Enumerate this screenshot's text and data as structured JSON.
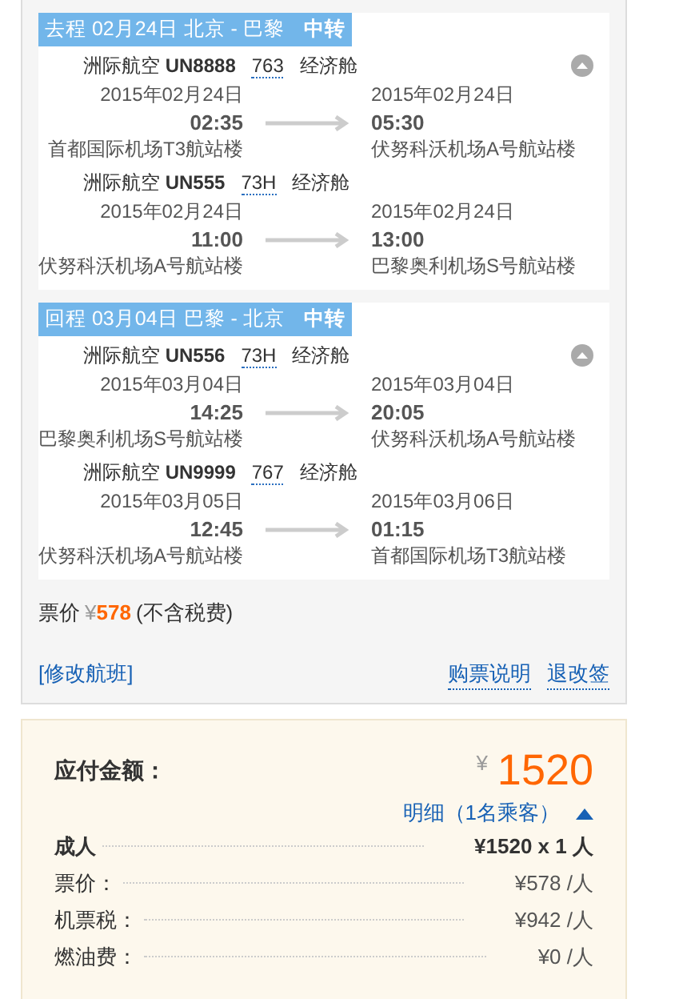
{
  "trips": [
    {
      "label": "去程 02月24日 北京 - 巴黎",
      "tag": "中转",
      "expanded": true,
      "segments": [
        {
          "airline": "洲际航空",
          "flight": "UN8888",
          "aircraft": "763",
          "cabin": "经济舱",
          "depart": {
            "date": "2015年02月24日",
            "time": "02:35",
            "airport": "首都国际机场T3航站楼"
          },
          "arrive": {
            "date": "2015年02月24日",
            "time": "05:30",
            "airport": "伏努科沃机场A号航站楼"
          }
        },
        {
          "airline": "洲际航空",
          "flight": "UN555",
          "aircraft": "73H",
          "cabin": "经济舱",
          "depart": {
            "date": "2015年02月24日",
            "time": "11:00",
            "airport": "伏努科沃机场A号航站楼"
          },
          "arrive": {
            "date": "2015年02月24日",
            "time": "13:00",
            "airport": "巴黎奥利机场S号航站楼"
          }
        }
      ]
    },
    {
      "label": "回程 03月04日 巴黎 - 北京",
      "tag": "中转",
      "expanded": true,
      "segments": [
        {
          "airline": "洲际航空",
          "flight": "UN556",
          "aircraft": "73H",
          "cabin": "经济舱",
          "depart": {
            "date": "2015年03月04日",
            "time": "14:25",
            "airport": "巴黎奥利机场S号航站楼"
          },
          "arrive": {
            "date": "2015年03月04日",
            "time": "20:05",
            "airport": "伏努科沃机场A号航站楼"
          }
        },
        {
          "airline": "洲际航空",
          "flight": "UN9999",
          "aircraft": "767",
          "cabin": "经济舱",
          "depart": {
            "date": "2015年03月05日",
            "time": "12:45",
            "airport": "伏努科沃机场A号航站楼"
          },
          "arrive": {
            "date": "2015年03月06日",
            "time": "01:15",
            "airport": "首都国际机场T3航站楼"
          }
        }
      ]
    }
  ],
  "fare": {
    "label": "票价",
    "currency": "¥",
    "amount": "578",
    "note": "(不含税费)"
  },
  "links": {
    "change": "[修改航班]",
    "actions": [
      "购票说明",
      "退改签"
    ]
  },
  "payment": {
    "title": "应付金额：",
    "currency": "¥",
    "total": "1520",
    "details": {
      "label": "明细（1名乘客）",
      "expanded": true
    },
    "rows": [
      {
        "kind": "header",
        "label": "成人",
        "value": "¥1520 x 1 人"
      },
      {
        "kind": "item",
        "label": "票价：",
        "value": "¥578 /人"
      },
      {
        "kind": "item",
        "label": "机票税：",
        "value": "¥942 /人"
      },
      {
        "kind": "item",
        "label": "燃油费：",
        "value": "¥0 /人"
      }
    ]
  }
}
